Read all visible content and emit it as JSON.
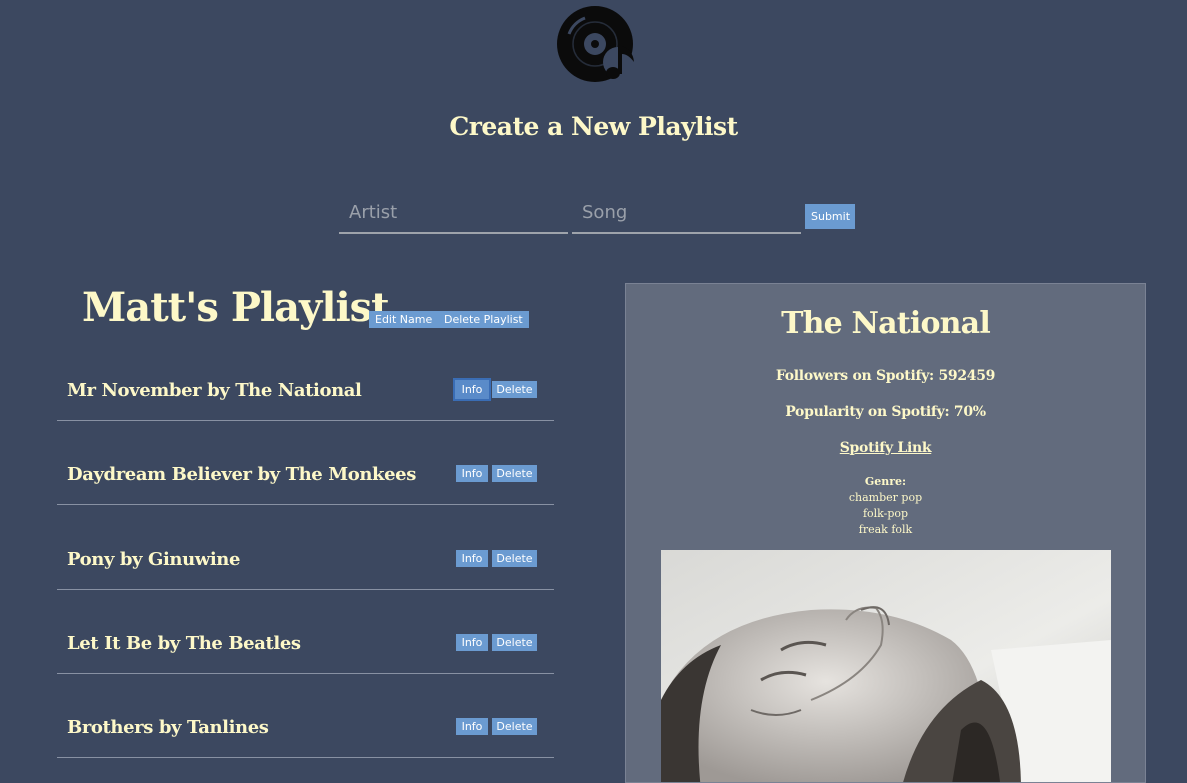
{
  "logo": {
    "icon": "vinyl-record-music-note-icon"
  },
  "page_title": "Create a New Playlist",
  "form": {
    "artist_placeholder": "Artist",
    "song_placeholder": "Song",
    "submit_label": "Submit"
  },
  "playlist": {
    "name": "Matt's Playlist",
    "edit_name_label": "Edit Name",
    "delete_playlist_label": "Delete Playlist",
    "songs": [
      {
        "title": "Mr November by The National",
        "info_label": "Info",
        "delete_label": "Delete"
      },
      {
        "title": "Daydream Believer by The Monkees",
        "info_label": "Info",
        "delete_label": "Delete"
      },
      {
        "title": "Pony by Ginuwine",
        "info_label": "Info",
        "delete_label": "Delete"
      },
      {
        "title": "Let It Be by The Beatles",
        "info_label": "Info",
        "delete_label": "Delete"
      },
      {
        "title": "Brothers by Tanlines",
        "info_label": "Info",
        "delete_label": "Delete"
      }
    ]
  },
  "artist_info": {
    "name": "The National",
    "followers": "Followers on Spotify: 592459",
    "popularity": "Popularity on Spotify: 70%",
    "link_text": "Spotify Link",
    "genre_label": "Genre:",
    "genres": [
      "chamber pop",
      "folk-pop",
      "freak folk"
    ],
    "image": "artist-photo-black-and-white-portrait"
  },
  "colors": {
    "background": "#3c4860",
    "panel": "#626b7d",
    "text": "#fdf8c8",
    "button": "#6b9bd1"
  }
}
